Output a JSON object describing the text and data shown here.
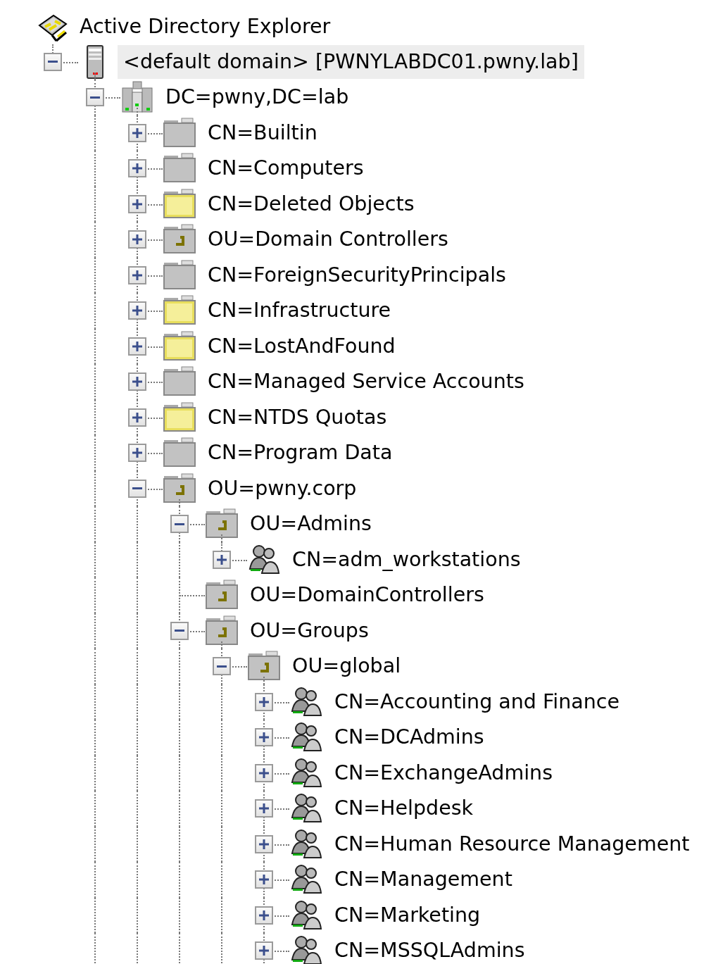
{
  "tree": {
    "title": "Active Directory Explorer",
    "kind": "console",
    "children": [
      {
        "label": "<default domain> [PWNYLABDC01.pwny.lab]",
        "kind": "server",
        "selected": true,
        "expanded": true,
        "continues_below": true,
        "children": [
          {
            "label": "DC=pwny,DC=lab",
            "kind": "domain",
            "selected": false,
            "expanded": true,
            "continues_below": true,
            "children": [
              {
                "label": "CN=Builtin",
                "kind": "folder",
                "selected": false,
                "expanded": false
              },
              {
                "label": "CN=Computers",
                "kind": "folder",
                "selected": false,
                "expanded": false
              },
              {
                "label": "CN=Deleted Objects",
                "kind": "container",
                "selected": false,
                "expanded": false
              },
              {
                "label": "OU=Domain Controllers",
                "kind": "ou",
                "selected": false,
                "expanded": false
              },
              {
                "label": "CN=ForeignSecurityPrincipals",
                "kind": "folder",
                "selected": false,
                "expanded": false
              },
              {
                "label": "CN=Infrastructure",
                "kind": "container",
                "selected": false,
                "expanded": false
              },
              {
                "label": "CN=LostAndFound",
                "kind": "container",
                "selected": false,
                "expanded": false
              },
              {
                "label": "CN=Managed Service Accounts",
                "kind": "folder",
                "selected": false,
                "expanded": false
              },
              {
                "label": "CN=NTDS Quotas",
                "kind": "container",
                "selected": false,
                "expanded": false
              },
              {
                "label": "CN=Program Data",
                "kind": "folder",
                "selected": false,
                "expanded": false
              },
              {
                "label": "OU=pwny.corp",
                "kind": "ou",
                "selected": false,
                "expanded": true,
                "continues_below": true,
                "children": [
                  {
                    "label": "OU=Admins",
                    "kind": "ou",
                    "selected": false,
                    "expanded": true,
                    "continues_below": false,
                    "children": [
                      {
                        "label": "CN=adm_workstations",
                        "kind": "group",
                        "selected": false,
                        "expanded": false
                      }
                    ]
                  },
                  {
                    "label": "OU=DomainControllers",
                    "kind": "ou",
                    "selected": false
                  },
                  {
                    "label": "OU=Groups",
                    "kind": "ou",
                    "selected": false,
                    "expanded": true,
                    "continues_below": true,
                    "children": [
                      {
                        "label": "OU=global",
                        "kind": "ou",
                        "selected": false,
                        "expanded": true,
                        "continues_below": true,
                        "children": [
                          {
                            "label": "CN=Accounting and Finance",
                            "kind": "group",
                            "selected": false,
                            "expanded": false
                          },
                          {
                            "label": "CN=DCAdmins",
                            "kind": "group",
                            "selected": false,
                            "expanded": false
                          },
                          {
                            "label": "CN=ExchangeAdmins",
                            "kind": "group",
                            "selected": false,
                            "expanded": false
                          },
                          {
                            "label": "CN=Helpdesk",
                            "kind": "group",
                            "selected": false,
                            "expanded": false
                          },
                          {
                            "label": "CN=Human Resource Management",
                            "kind": "group",
                            "selected": false,
                            "expanded": false
                          },
                          {
                            "label": "CN=Management",
                            "kind": "group",
                            "selected": false,
                            "expanded": false
                          },
                          {
                            "label": "CN=Marketing",
                            "kind": "group",
                            "selected": false,
                            "expanded": false
                          },
                          {
                            "label": "CN=MSSQLAdmins",
                            "kind": "group",
                            "selected": false,
                            "expanded": false
                          }
                        ]
                      }
                    ]
                  }
                ]
              }
            ]
          }
        ]
      }
    ]
  }
}
